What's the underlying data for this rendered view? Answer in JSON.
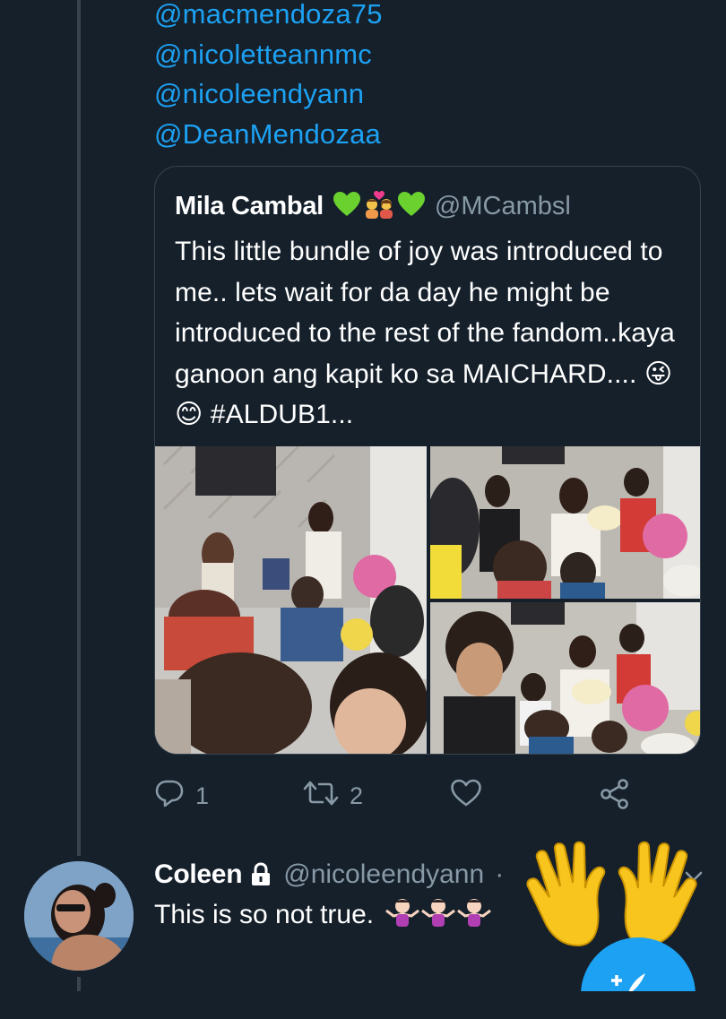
{
  "mentions": [
    "@macmendoza75",
    "@nicoletteannmc",
    "@nicoleendyann",
    "@DeanMendozaa"
  ],
  "quoted_tweet": {
    "name": "Mila Cambal",
    "name_emojis": [
      "green-heart-icon",
      "couple-with-heart-icon",
      "green-heart-icon"
    ],
    "handle": "@MCambsl",
    "text": "This little bundle of joy was introduced to me.. lets wait for da day he might be introduced to the rest of the fandom..kaya ganoon ang kapit ko sa MAICHARD.... 😜😊  #ALDUB1...",
    "photos": [
      "party-photo-1",
      "party-photo-2",
      "party-photo-3"
    ]
  },
  "actions": {
    "reply_count": "1",
    "retweet_count": "2",
    "like_count": "",
    "icons": [
      "reply-icon",
      "retweet-icon",
      "like-icon",
      "share-icon"
    ]
  },
  "reply": {
    "name": "Coleen",
    "handle": "@nicoleendyann",
    "handle_suffix": "·",
    "text": "This is so not true.",
    "emojis": [
      "person-shrugging-icon",
      "person-shrugging-icon",
      "person-shrugging-icon"
    ]
  },
  "overlays": {
    "sticker": "raised-hands-icon",
    "compose_button": "compose-tweet-button"
  },
  "colors": {
    "background": "#15202b",
    "link": "#1da1f2",
    "secondary_text": "#8899a6",
    "border": "#38444d"
  }
}
